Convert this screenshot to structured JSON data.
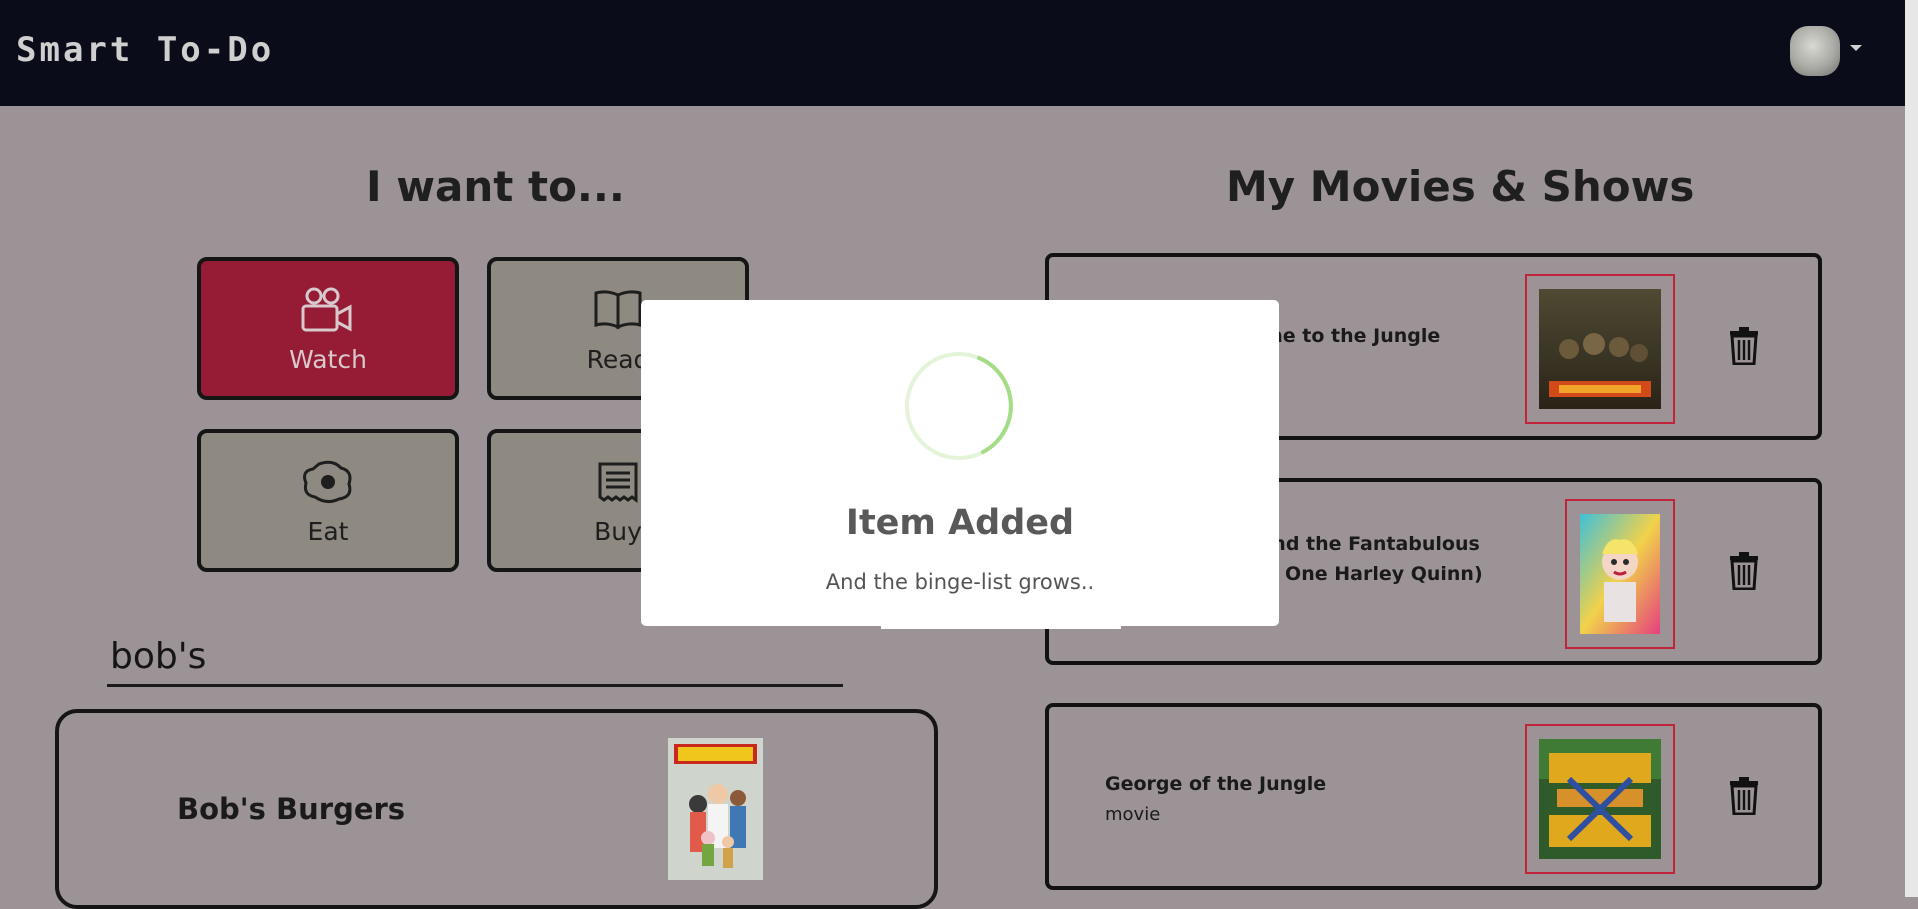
{
  "app": {
    "brand": "Smart To-Do"
  },
  "nav": {
    "avatar_icon": "user-avatar",
    "menu_icon": "chevron-down-icon"
  },
  "left": {
    "heading": "I want to...",
    "categories": [
      {
        "label": "Watch",
        "icon": "video-camera-icon",
        "active": true
      },
      {
        "label": "Read",
        "icon": "book-icon",
        "active": false
      },
      {
        "label": "Eat",
        "icon": "fried-egg-icon",
        "active": false
      },
      {
        "label": "Buy",
        "icon": "receipt-icon",
        "active": false
      }
    ],
    "search": {
      "value": "bob's"
    },
    "results": [
      {
        "title": "Bob's Burgers",
        "poster_icon": "bobs-burgers-poster"
      }
    ]
  },
  "right": {
    "heading": "My Movies & Shows",
    "items": [
      {
        "title_lines": [
          "Jumanji: Welcome to the Jungle"
        ],
        "type": "",
        "poster_icon": "jumanji-poster"
      },
      {
        "title_lines": [
          "Birds of Prey: And the Fantabulous",
          "Emancipation of One Harley Quinn)"
        ],
        "type": "",
        "poster_icon": "birds-of-prey-poster"
      },
      {
        "title_lines": [
          "George of the Jungle"
        ],
        "type": "movie",
        "poster_icon": "george-of-the-jungle-poster"
      }
    ]
  },
  "modal": {
    "title": "Item Added",
    "text": "And the binge-list grows.."
  },
  "colors": {
    "nav_bg": "#0b0c19",
    "backdrop": "#9c9397",
    "active_tile": "#961c35",
    "tile": "#8e8981",
    "poster_border": "#c0243b",
    "spinner": "#a5dc86"
  }
}
